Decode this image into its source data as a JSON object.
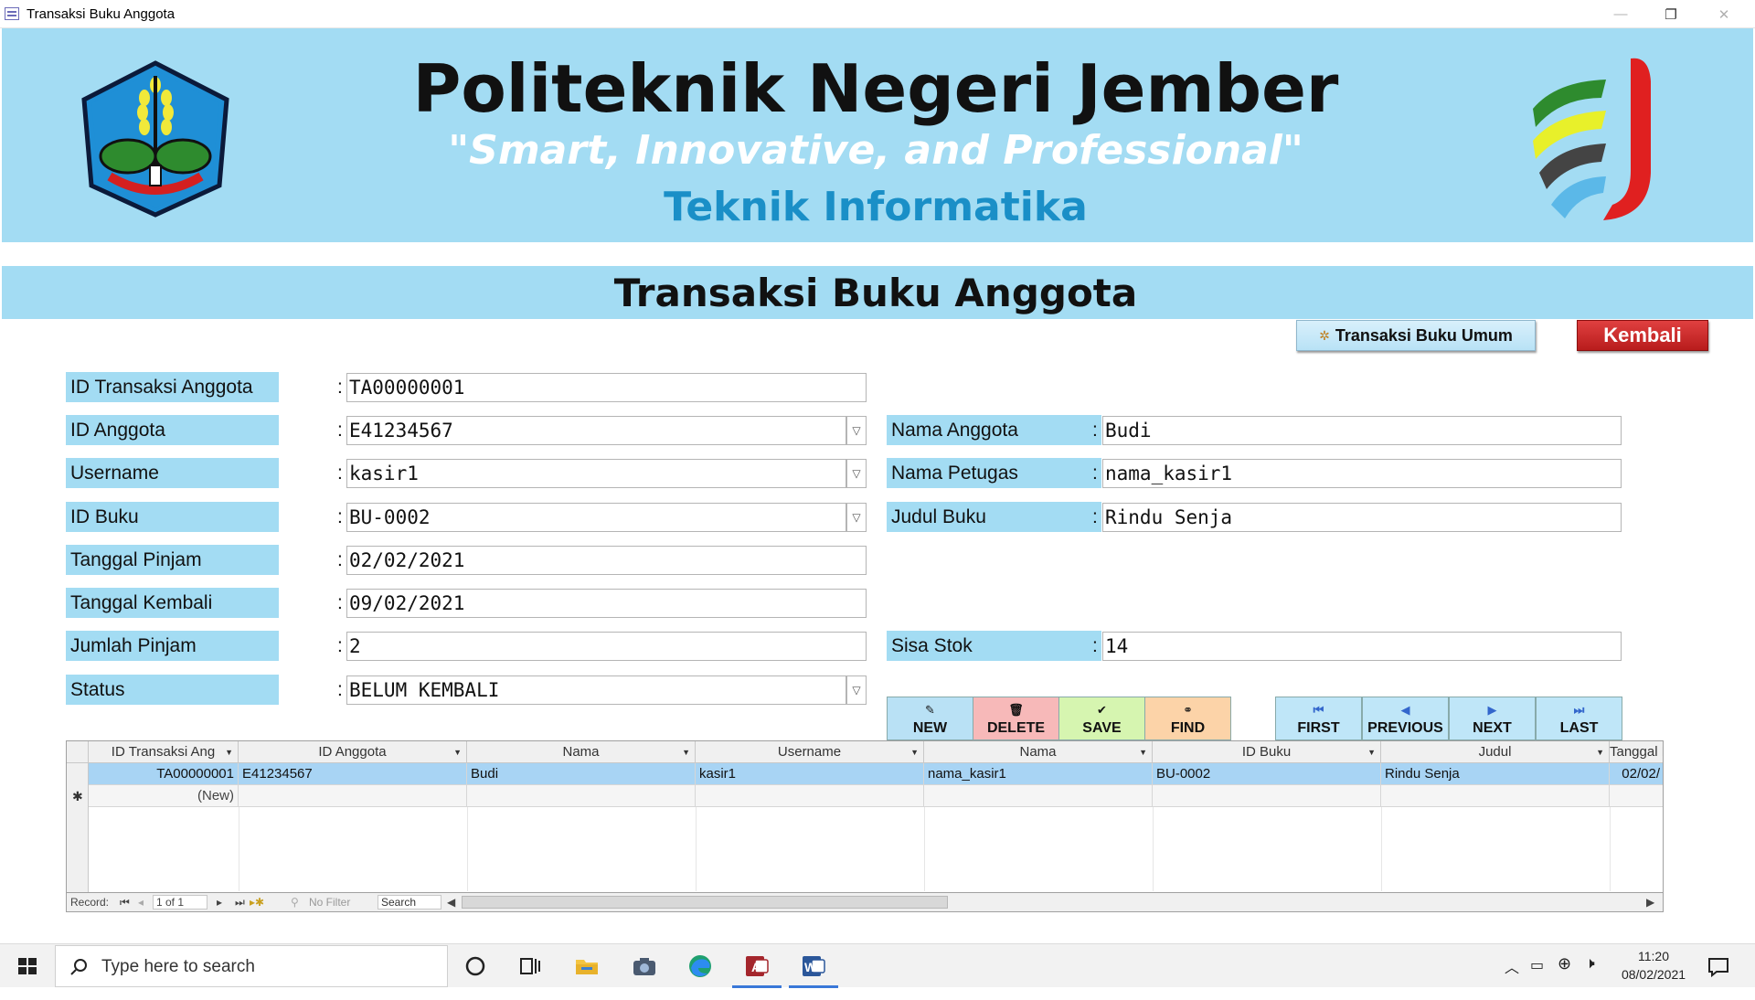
{
  "window": {
    "title": "Transaksi Buku Anggota",
    "minimize": "—",
    "restore": "❐",
    "close": "✕"
  },
  "banner": {
    "institution": "Politeknik Negeri Jember",
    "motto": "\"Smart, Innovative, and Professional\"",
    "department": "Teknik Informatika"
  },
  "section_title": "Transaksi Buku Anggota",
  "buttons": {
    "umum": "Transaksi Buku Umum",
    "kembali": "Kembali"
  },
  "form": {
    "left": [
      {
        "label": "ID Transaksi Anggota",
        "value": "TA00000001",
        "dropdown": false
      },
      {
        "label": "ID Anggota",
        "value": "E41234567",
        "dropdown": true
      },
      {
        "label": "Username",
        "value": "kasir1",
        "dropdown": true
      },
      {
        "label": "ID Buku",
        "value": "BU-0002",
        "dropdown": true
      },
      {
        "label": "Tanggal Pinjam",
        "value": "02/02/2021",
        "dropdown": false
      },
      {
        "label": "Tanggal Kembali",
        "value": "09/02/2021",
        "dropdown": false
      },
      {
        "label": "Jumlah Pinjam",
        "value": "2",
        "dropdown": false
      },
      {
        "label": "Status",
        "value": "BELUM KEMBALI",
        "dropdown": true
      }
    ],
    "right": {
      "nama_anggota": {
        "label": "Nama Anggota",
        "value": "Budi"
      },
      "nama_petugas": {
        "label": "Nama Petugas",
        "value": "nama_kasir1"
      },
      "judul_buku": {
        "label": "Judul Buku",
        "value": "Rindu Senja"
      },
      "sisa_stok": {
        "label": "Sisa Stok",
        "value": "14"
      }
    },
    "colon": ":"
  },
  "commands": {
    "new": "NEW",
    "delete": "DELETE",
    "save": "SAVE",
    "find": "FIND",
    "first": "FIRST",
    "previous": "PREVIOUS",
    "next": "NEXT",
    "last": "LAST"
  },
  "grid": {
    "columns": [
      "ID Transaksi Ang",
      "ID Anggota",
      "Nama",
      "Username",
      "Nama",
      "ID Buku",
      "Judul",
      "Tanggal Pir"
    ],
    "rows": [
      [
        "TA00000001",
        "E41234567",
        "Budi",
        "kasir1",
        "nama_kasir1",
        "BU-0002",
        "Rindu Senja",
        "02/02/"
      ]
    ],
    "new_row": "(New)",
    "new_marker": "✱"
  },
  "record_nav": {
    "label": "Record:",
    "position": "1 of 1",
    "filter": "No Filter",
    "search": "Search"
  },
  "taskbar": {
    "search_placeholder": "Type here to search",
    "time": "11:20",
    "date": "08/02/2021"
  },
  "colors": {
    "banner": "#a3dcf3",
    "new": "#b9e1f5",
    "delete": "#f7b9b9",
    "save": "#d6f5b0",
    "find": "#fcd3a8",
    "nav": "#bfe6f8",
    "kembali": "#c62828"
  }
}
